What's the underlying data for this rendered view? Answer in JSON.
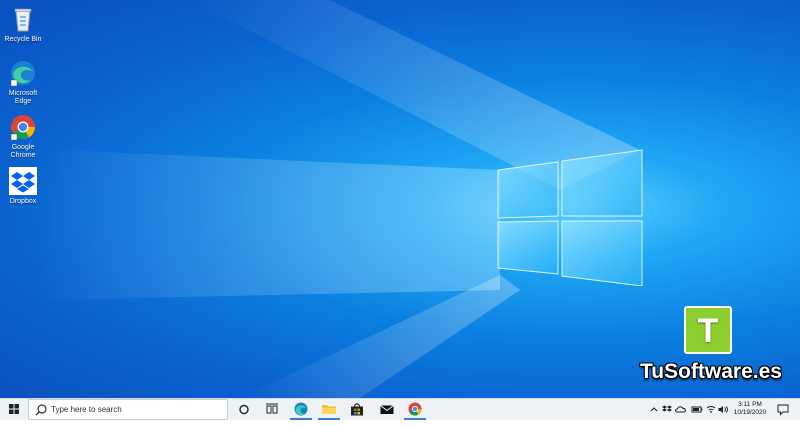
{
  "desktop_icons": [
    {
      "label": "Recycle Bin",
      "icon": "recycle-bin-icon"
    },
    {
      "label": "Microsoft Edge",
      "icon": "edge-icon"
    },
    {
      "label": "Google Chrome",
      "icon": "chrome-icon"
    },
    {
      "label": "Dropbox",
      "icon": "dropbox-icon"
    }
  ],
  "watermark": {
    "letter": "T",
    "text": "TuSoftware.es"
  },
  "taskbar": {
    "search_placeholder": "Type here to search",
    "clock": {
      "time": "3:11 PM",
      "date": "10/19/2020"
    }
  },
  "colors": {
    "desktop_blue": "#0b7fe0",
    "watermark_green": "#8ccf2f",
    "taskbar_bg": "#eef1f5"
  }
}
